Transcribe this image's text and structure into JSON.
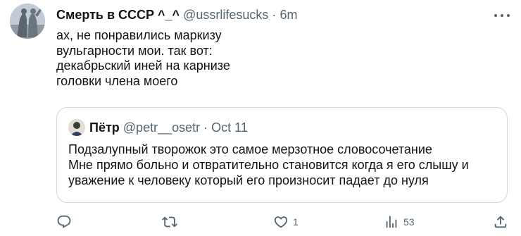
{
  "tweet": {
    "author_name": "Смерть в СССР ^_^",
    "handle": "@ussrlifesucks",
    "separator": "·",
    "time": "6m",
    "text_lines": [
      "ах, не понравились маркизу",
      "вульгарности мои. так вот:",
      "декабрьский иней на карнизе",
      "головки члена моего"
    ]
  },
  "quote": {
    "author_name": "Пётр",
    "handle": "@petr__osetr",
    "separator": "·",
    "time": "Oct 11",
    "text_lines": [
      "Подзалупный творожок это самое мерзотное словосочетание",
      "Мне прямо больно и отвратительно становится когда я его слышу и",
      "уважение к человеку который его произносит падает до нуля"
    ]
  },
  "actions": {
    "reply_icon": "reply-icon",
    "retweet_icon": "retweet-icon",
    "like_icon": "heart-icon",
    "like_count": "1",
    "views_icon": "views-icon",
    "views_count": "53",
    "share_icon": "share-icon"
  },
  "colors": {
    "text": "#0f1419",
    "secondary": "#536471",
    "border": "#cfd9de"
  }
}
